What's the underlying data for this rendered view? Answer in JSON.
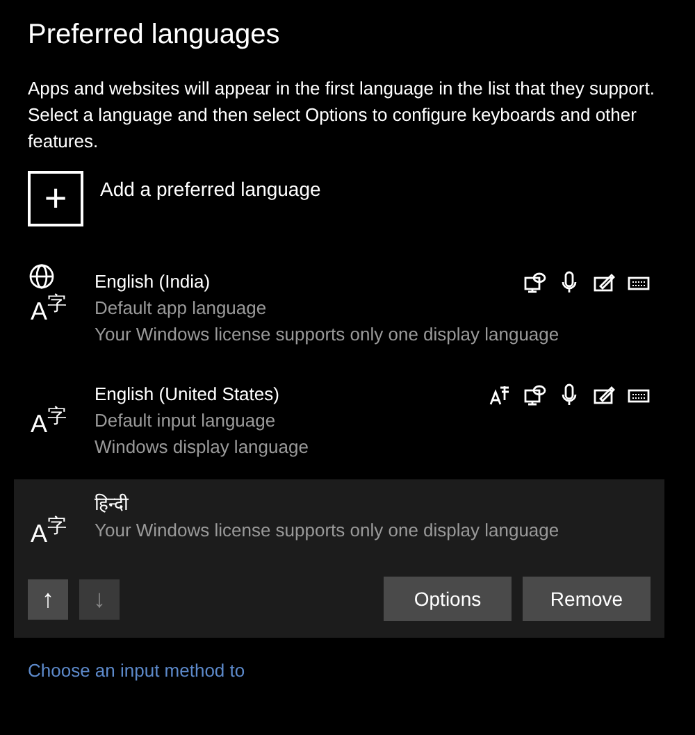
{
  "title": "Preferred languages",
  "description": "Apps and websites will appear in the first language in the list that they support. Select a language and then select Options to configure keyboards and other features.",
  "add_button": {
    "icon": "+",
    "label": "Add a preferred language"
  },
  "languages": [
    {
      "name": "English (India)",
      "icon_main": "A",
      "icon_sup": "字",
      "globe": true,
      "selected": false,
      "details": [
        "Default app language",
        "Your Windows license supports only one display language"
      ],
      "features": [
        {
          "kind": "display"
        },
        {
          "kind": "speech"
        },
        {
          "kind": "handwriting"
        },
        {
          "kind": "keyboard"
        }
      ]
    },
    {
      "name": "English (United States)",
      "icon_main": "A",
      "icon_sup": "字",
      "globe": false,
      "selected": false,
      "details": [
        "Default input language",
        "Windows display language"
      ],
      "features": [
        {
          "kind": "tts"
        },
        {
          "kind": "display"
        },
        {
          "kind": "speech"
        },
        {
          "kind": "handwriting"
        },
        {
          "kind": "keyboard"
        }
      ]
    },
    {
      "name": "हिन्दी",
      "icon_main": "A",
      "icon_sup": "字",
      "globe": false,
      "selected": true,
      "details": [
        "Your Windows license supports only one display language"
      ]
    }
  ],
  "actions": {
    "move_up": {
      "icon": "↑",
      "disabled": false
    },
    "move_down": {
      "icon": "↓",
      "disabled": true
    },
    "buttons": [
      "Options",
      "Remove"
    ]
  },
  "link": "Choose an input method to"
}
